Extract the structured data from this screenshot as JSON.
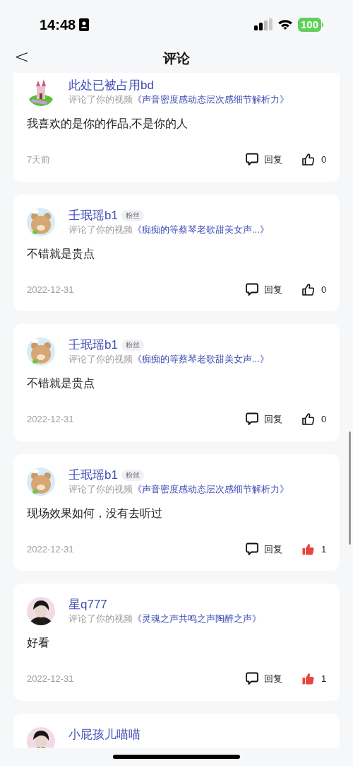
{
  "status_bar": {
    "time": "14:48",
    "battery": "100"
  },
  "header": {
    "back": "<",
    "title": "评论"
  },
  "comments": [
    {
      "name": "此处已被占用bd",
      "action": "评论了你的视频",
      "video": "《声音密度感动态层次感细节解析力》",
      "text": "我喜欢的是你的作品,不是你的人",
      "date": "7天前",
      "reply": "回复",
      "likes": "0",
      "liked": false
    },
    {
      "name": "壬珉瑶b1",
      "badge": "粉丝",
      "action": "评论了你的视频",
      "video": "《痴痴的等蔡琴老歌甜美女声...》",
      "text": "不错就是贵点",
      "date": "2022-12-31",
      "reply": "回复",
      "likes": "0",
      "liked": false
    },
    {
      "name": "壬珉瑶b1",
      "badge": "粉丝",
      "action": "评论了你的视频",
      "video": "《痴痴的等蔡琴老歌甜美女声...》",
      "text": "不错就是贵点",
      "date": "2022-12-31",
      "reply": "回复",
      "likes": "0",
      "liked": false
    },
    {
      "name": "壬珉瑶b1",
      "badge": "粉丝",
      "action": "评论了你的视频",
      "video": "《声音密度感动态层次感细节解析力》",
      "text": "现场效果如何，没有去听过",
      "date": "2022-12-31",
      "reply": "回复",
      "likes": "1",
      "liked": true
    },
    {
      "name": "星q777",
      "action": "评论了你的视频",
      "video": "《灵魂之声共鸣之声陶醉之声》",
      "text": "好看",
      "date": "2022-12-31",
      "reply": "回复",
      "likes": "1",
      "liked": true
    },
    {
      "name": "小屁孩儿喵喵"
    }
  ]
}
